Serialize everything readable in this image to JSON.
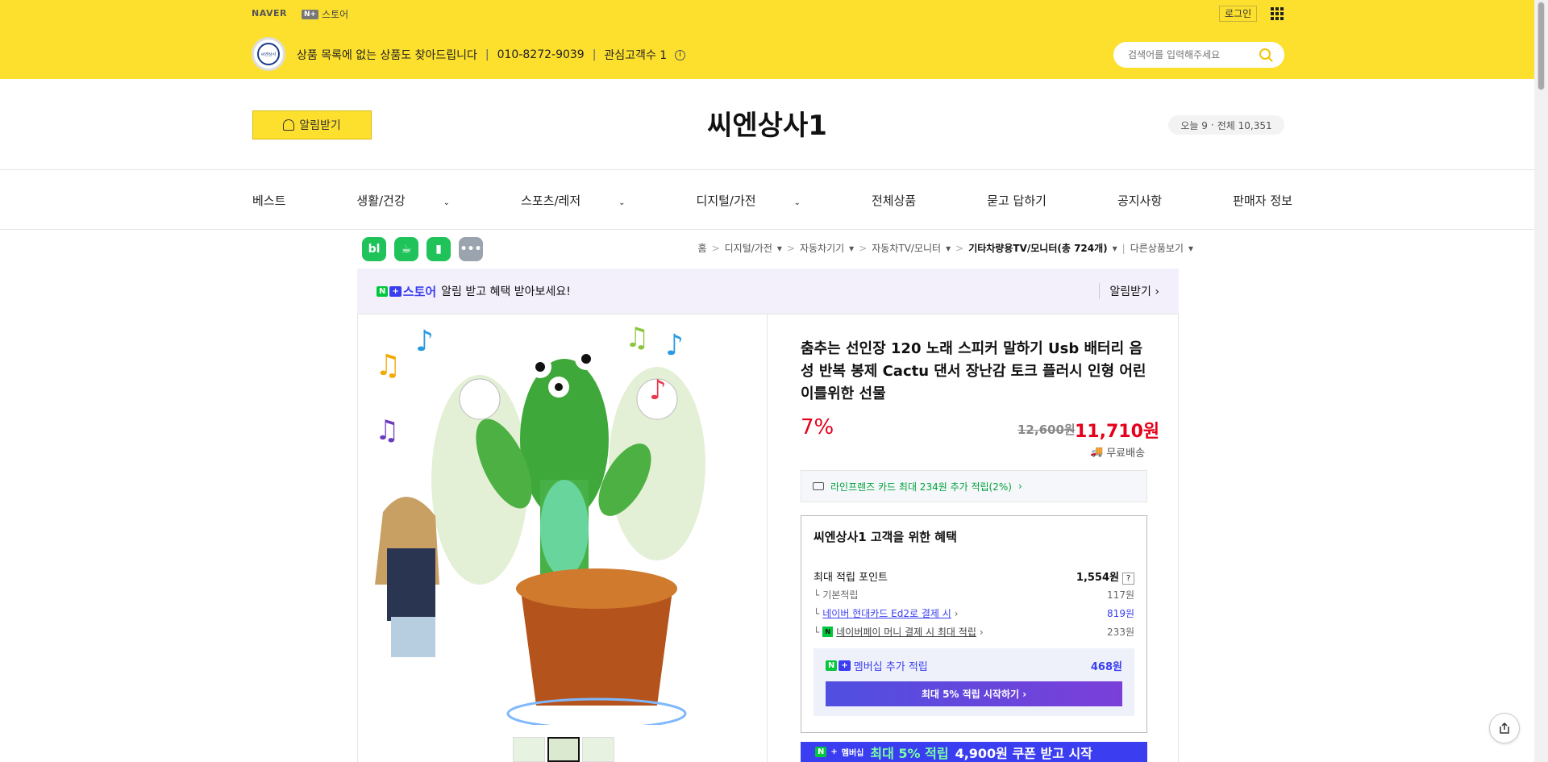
{
  "topbar": {
    "naver": "NAVER",
    "nbadge": "N+",
    "store": "스토어",
    "login": "로그인"
  },
  "storebar": {
    "logo_text": "씨엔상사",
    "desc": "상품 목록에 없는 상품도 찾아드립니다",
    "phone": "010-8272-9039",
    "interest": "관심고객수 1",
    "search_placeholder": "검색어를 입력해주세요"
  },
  "header": {
    "alarm": "알림받기",
    "title": "씨엔상사1",
    "today": "오늘 9",
    "total": "전체 10,351"
  },
  "nav": [
    {
      "label": "베스트",
      "dropdown": false
    },
    {
      "label": "생활/건강",
      "dropdown": true
    },
    {
      "label": "스포츠/레저",
      "dropdown": true
    },
    {
      "label": "디지털/가전",
      "dropdown": true
    },
    {
      "label": "전체상품",
      "dropdown": false
    },
    {
      "label": "묻고 답하기",
      "dropdown": false
    },
    {
      "label": "공지사항",
      "dropdown": false
    },
    {
      "label": "판매자 정보",
      "dropdown": false
    }
  ],
  "util": [
    {
      "name": "blog-share",
      "label": "bl",
      "color": "#1fc35a"
    },
    {
      "name": "cafe-share",
      "label": "☕",
      "color": "#1fc35a"
    },
    {
      "name": "bookmark-share",
      "label": "▮",
      "color": "#1fc35a"
    },
    {
      "name": "more",
      "label": "•••",
      "color": "#9aa3ae"
    }
  ],
  "breadcrumb": [
    "홈",
    "디지털/가전",
    "자동차기기",
    "자동차TV/모니터",
    "기타차량용TV/모니터(총 724개)",
    "다른상품보기"
  ],
  "promo": {
    "store": "스토어",
    "text": "알림 받고 혜택 받아보세요!",
    "right": "알림받기"
  },
  "product": {
    "title": "춤추는 선인장 120 노래 스피커 말하기 Usb 배터리 음성 반복 봉제 Cactu 댄서 장난감 토크 플러시 인형 어린이를위한 선물",
    "discount": "7%",
    "original_price": "12,600원",
    "price": "11,710원",
    "shipping": "무료배송",
    "card": "라인프렌즈 카드 최대 234원 추가 적립(2%)"
  },
  "benefit": {
    "title": "씨엔상사1 고객을 위한 혜택",
    "rows": [
      {
        "label": "최대 적립 포인트",
        "value": "1,554원"
      },
      {
        "label": "기본적립",
        "value": "117원"
      },
      {
        "label": "네이버 현대카드 Ed2로 결제 시",
        "value": "819원"
      },
      {
        "label": "네이버페이 머니 결제 시 최대 적립",
        "value": "233원"
      }
    ],
    "member_label": "멤버십 추가 적립",
    "member_value": "468원",
    "member_btn": "최대 5% 적립 시작하기"
  },
  "coupon": {
    "badge": "멤버십",
    "highlight": "최대 5% 적립",
    "text": "4,900원 쿠폰 받고 시작"
  }
}
